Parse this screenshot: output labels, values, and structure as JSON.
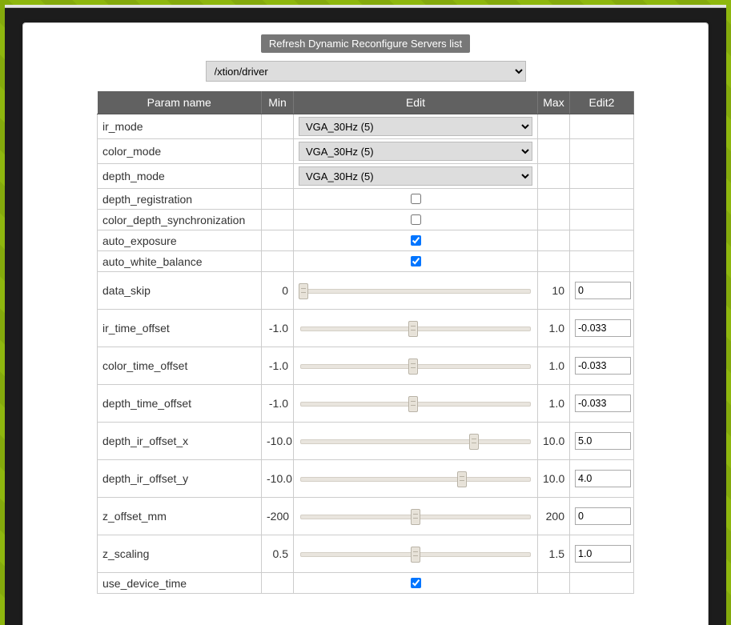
{
  "header": {
    "refresh_label": "Refresh Dynamic Reconfigure Servers list",
    "server_selected": "/xtion/driver"
  },
  "columns": {
    "name": "Param name",
    "min": "Min",
    "edit": "Edit",
    "max": "Max",
    "edit2": "Edit2"
  },
  "params": [
    {
      "name": "ir_mode",
      "type": "select",
      "value": "VGA_30Hz (5)"
    },
    {
      "name": "color_mode",
      "type": "select",
      "value": "VGA_30Hz (5)"
    },
    {
      "name": "depth_mode",
      "type": "select",
      "value": "VGA_30Hz (5)"
    },
    {
      "name": "depth_registration",
      "type": "checkbox",
      "checked": false
    },
    {
      "name": "color_depth_synchronization",
      "type": "checkbox",
      "checked": false
    },
    {
      "name": "auto_exposure",
      "type": "checkbox",
      "checked": true
    },
    {
      "name": "auto_white_balance",
      "type": "checkbox",
      "checked": true
    },
    {
      "name": "data_skip",
      "type": "slider",
      "min": "0",
      "max": "10",
      "edit2": "0",
      "thumb_pct": 2
    },
    {
      "name": "ir_time_offset",
      "type": "slider",
      "min": "-1.0",
      "max": "1.0",
      "edit2": "-0.033",
      "thumb_pct": 49
    },
    {
      "name": "color_time_offset",
      "type": "slider",
      "min": "-1.0",
      "max": "1.0",
      "edit2": "-0.033",
      "thumb_pct": 49
    },
    {
      "name": "depth_time_offset",
      "type": "slider",
      "min": "-1.0",
      "max": "1.0",
      "edit2": "-0.033",
      "thumb_pct": 49
    },
    {
      "name": "depth_ir_offset_x",
      "type": "slider",
      "min": "-10.0",
      "max": "10.0",
      "edit2": "5.0",
      "thumb_pct": 75
    },
    {
      "name": "depth_ir_offset_y",
      "type": "slider",
      "min": "-10.0",
      "max": "10.0",
      "edit2": "4.0",
      "thumb_pct": 70
    },
    {
      "name": "z_offset_mm",
      "type": "slider",
      "min": "-200",
      "max": "200",
      "edit2": "0",
      "thumb_pct": 50
    },
    {
      "name": "z_scaling",
      "type": "slider",
      "min": "0.5",
      "max": "1.5",
      "edit2": "1.0",
      "thumb_pct": 50
    },
    {
      "name": "use_device_time",
      "type": "checkbox",
      "checked": true
    }
  ]
}
